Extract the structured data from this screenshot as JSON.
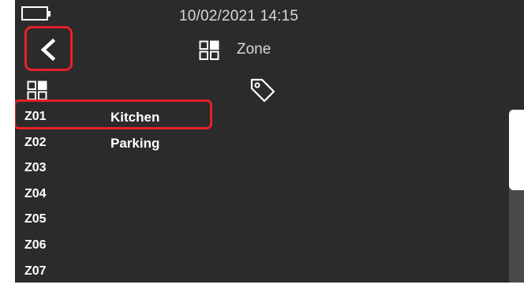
{
  "status_bar": {
    "battery_icon": "battery-icon",
    "datetime": "10/02/2021  14:15"
  },
  "header": {
    "back_icon": "chevron-left-icon",
    "title_icon": "grid-icon",
    "title": "Zone"
  },
  "columns": {
    "zone_icon": "grid-icon",
    "tag_icon": "tag-icon"
  },
  "zones": [
    {
      "code": "Z01",
      "name": "Kitchen",
      "selected": true
    },
    {
      "code": "Z02",
      "name": "Parking"
    },
    {
      "code": "Z03",
      "name": ""
    },
    {
      "code": "Z04",
      "name": ""
    },
    {
      "code": "Z05",
      "name": ""
    },
    {
      "code": "Z06",
      "name": ""
    },
    {
      "code": "Z07",
      "name": ""
    }
  ],
  "colors": {
    "background": "#2b2b2b",
    "highlight": "#e8202a",
    "text": "#ffffff"
  }
}
